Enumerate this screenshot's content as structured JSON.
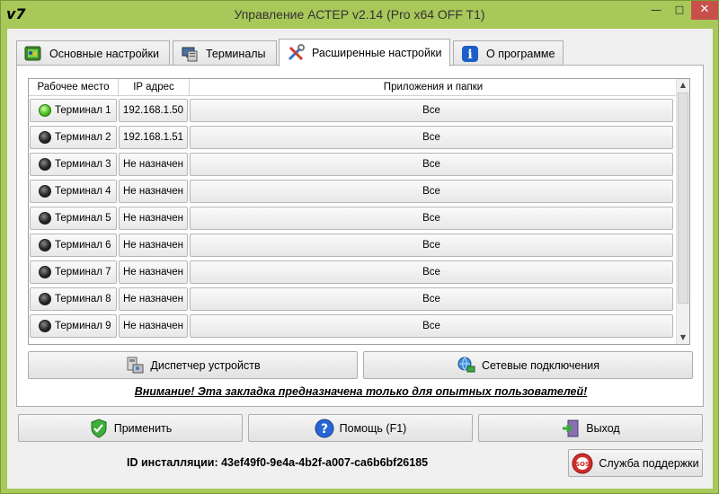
{
  "window": {
    "title": "Управление АСТЕР v2.14 (Pro x64 OFF T1)",
    "icon_text": "v7",
    "controls": {
      "minimize": "—",
      "maximize": "□",
      "close": "✕"
    }
  },
  "tabs": [
    {
      "label": "Основные настройки",
      "icon": "settings-board-icon",
      "active": false
    },
    {
      "label": "Терминалы",
      "icon": "monitor-icon",
      "active": false
    },
    {
      "label": "Расширенные настройки",
      "icon": "tools-icon",
      "active": true
    },
    {
      "label": "О программе",
      "icon": "info-icon",
      "active": false
    }
  ],
  "grid": {
    "columns": [
      "Рабочее место",
      "IP адрес",
      "Приложения и папки"
    ],
    "rows": [
      {
        "terminal": "Терминал 1",
        "ip": "192.168.1.50",
        "apps": "Все",
        "status": "on"
      },
      {
        "terminal": "Терминал 2",
        "ip": "192.168.1.51",
        "apps": "Все",
        "status": "off"
      },
      {
        "terminal": "Терминал 3",
        "ip": "Не назначен",
        "apps": "Все",
        "status": "off"
      },
      {
        "terminal": "Терминал 4",
        "ip": "Не назначен",
        "apps": "Все",
        "status": "off"
      },
      {
        "terminal": "Терминал 5",
        "ip": "Не назначен",
        "apps": "Все",
        "status": "off"
      },
      {
        "terminal": "Терминал 6",
        "ip": "Не назначен",
        "apps": "Все",
        "status": "off"
      },
      {
        "terminal": "Терминал 7",
        "ip": "Не назначен",
        "apps": "Все",
        "status": "off"
      },
      {
        "terminal": "Терминал 8",
        "ip": "Не назначен",
        "apps": "Все",
        "status": "off"
      },
      {
        "terminal": "Терминал 9",
        "ip": "Не назначен",
        "apps": "Все",
        "status": "off"
      }
    ]
  },
  "panel_buttons": {
    "device_manager": "Диспетчер устройств",
    "network": "Сетевые подключения"
  },
  "warning": "Внимание! Эта закладка предназначена только для опытных пользователей!",
  "footer": {
    "apply": "Применить",
    "help": "Помощь (F1)",
    "exit": "Выход",
    "install_id": "ID инсталляции: 43ef49f0-9e4a-4b2f-a007-ca6b6bf26185",
    "support": "Служба поддержки",
    "sos_badge": "SOS"
  },
  "colors": {
    "titlebar": "#a8c85a",
    "close": "#c7504a",
    "led_on": "#4bbf1e",
    "led_off": "#222222"
  }
}
